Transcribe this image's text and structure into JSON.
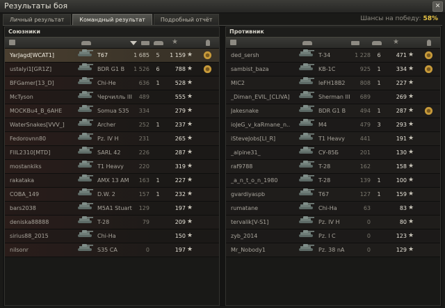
{
  "window": {
    "title": "Результаты боя",
    "close_label": "✕"
  },
  "tabs": [
    "Личный результат",
    "Командный результат",
    "Подробный отчёт"
  ],
  "active_tab": 1,
  "chance": {
    "label": "Шансы на победу:",
    "value": "58%"
  },
  "colors": {
    "accent": "#e9c546",
    "self_row": "#4a3f30",
    "ally_tint": "#2a1d1a",
    "medal": "#c79a3a"
  },
  "allies": {
    "title": "Союзники",
    "rows": [
      {
        "player": "YarJagd[WCAT1]",
        "vehicle": "T67",
        "damage": "1 685",
        "kills": "5",
        "xp": "1 159",
        "medal": true,
        "self": true
      },
      {
        "player": "ustalyi1[GR1Z]",
        "vehicle": "BDR G1 B",
        "damage": "1 526",
        "kills": "6",
        "xp": "788",
        "medal": true
      },
      {
        "player": "BFGamer[13_D]",
        "vehicle": "Chi-He",
        "damage": "636",
        "kills": "1",
        "xp": "528"
      },
      {
        "player": "McTyson",
        "vehicle": "Черчилль III",
        "damage": "489",
        "kills": "",
        "xp": "555"
      },
      {
        "player": "МОСКВu4_В_6АНЕ",
        "vehicle": "Somua S35",
        "damage": "334",
        "kills": "",
        "xp": "279"
      },
      {
        "player": "WaterSnakes[VVV_]",
        "vehicle": "Archer",
        "damage": "252",
        "kills": "1",
        "xp": "237"
      },
      {
        "player": "Fedorovnn80",
        "vehicle": "Pz. IV H",
        "damage": "231",
        "kills": "",
        "xp": "265"
      },
      {
        "player": "FIIL2310[MTD]",
        "vehicle": "SARL 42",
        "damage": "226",
        "kills": "",
        "xp": "287"
      },
      {
        "player": "mostankiks",
        "vehicle": "T1 Heavy",
        "damage": "220",
        "kills": "",
        "xp": "319"
      },
      {
        "player": "rakataka",
        "vehicle": "AMX 13 AM",
        "damage": "163",
        "kills": "1",
        "xp": "227"
      },
      {
        "player": "COBA_149",
        "vehicle": "D.W. 2",
        "damage": "157",
        "kills": "1",
        "xp": "232"
      },
      {
        "player": "bars2038",
        "vehicle": "M5A1 Stuart",
        "damage": "129",
        "kills": "",
        "xp": "197"
      },
      {
        "player": "deniska88888",
        "vehicle": "T-28",
        "damage": "79",
        "kills": "",
        "xp": "209"
      },
      {
        "player": "sirius88_2015",
        "vehicle": "Chi-Ha",
        "damage": "",
        "kills": "",
        "xp": "150"
      },
      {
        "player": "nilsonr",
        "vehicle": "S35 CA",
        "damage": "0",
        "kills": "",
        "xp": "197"
      }
    ]
  },
  "enemies": {
    "title": "Противник",
    "rows": [
      {
        "player": "ded_sersh",
        "vehicle": "T-34",
        "damage": "1 228",
        "kills": "6",
        "xp": "471",
        "medal": true
      },
      {
        "player": "sambist_baza",
        "vehicle": "KB-1C",
        "damage": "925",
        "kills": "1",
        "xp": "334",
        "medal": true
      },
      {
        "player": "MIC2",
        "vehicle": "leFH18B2",
        "damage": "808",
        "kills": "1",
        "xp": "227"
      },
      {
        "player": "_Diman_EVIL_[CLIVA]",
        "vehicle": "Sherman III",
        "damage": "689",
        "kills": "",
        "xp": "269"
      },
      {
        "player": "Jakesnake",
        "vehicle": "BDR G1 B",
        "damage": "494",
        "kills": "1",
        "xp": "287",
        "medal": true
      },
      {
        "player": "ioJeG_v_kaRmane_n..",
        "vehicle": "M4",
        "damage": "479",
        "kills": "3",
        "xp": "293"
      },
      {
        "player": "iSteveJobs[LI_R]",
        "vehicle": "T1 Heavy",
        "damage": "441",
        "kills": "",
        "xp": "191"
      },
      {
        "player": "_alpine31_",
        "vehicle": "СУ-85Б",
        "damage": "201",
        "kills": "",
        "xp": "130"
      },
      {
        "player": "raf9788",
        "vehicle": "T-28",
        "damage": "162",
        "kills": "",
        "xp": "158"
      },
      {
        "player": "_a_n_t_o_n_1980",
        "vehicle": "T-28",
        "damage": "139",
        "kills": "1",
        "xp": "100"
      },
      {
        "player": "gvardiyaspb",
        "vehicle": "T67",
        "damage": "127",
        "kills": "1",
        "xp": "159"
      },
      {
        "player": "rumatane",
        "vehicle": "Chi-Ha",
        "damage": "63",
        "kills": "",
        "xp": "83"
      },
      {
        "player": "tervalik[V-S1]",
        "vehicle": "Pz. IV H",
        "damage": "0",
        "kills": "",
        "xp": "80"
      },
      {
        "player": "zyb_2014",
        "vehicle": "Pz. I C",
        "damage": "0",
        "kills": "",
        "xp": "123"
      },
      {
        "player": "Mr_Nobody1",
        "vehicle": "Pz. 38 nA",
        "damage": "0",
        "kills": "",
        "xp": "129"
      }
    ]
  }
}
